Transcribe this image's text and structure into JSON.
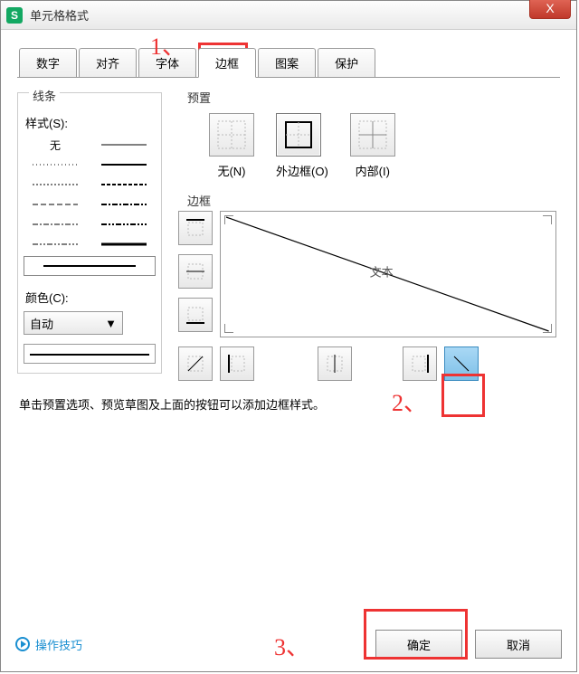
{
  "window": {
    "title": "单元格格式",
    "app_glyph": "S"
  },
  "close_btn": "X",
  "tabs": [
    "数字",
    "对齐",
    "字体",
    "边框",
    "图案",
    "保护"
  ],
  "active_tab_index": 3,
  "line_section": {
    "legend": "线条",
    "style_label": "样式(S):",
    "none_label": "无",
    "color_label": "颜色(C):",
    "color_value": "自动",
    "dropdown_glyph": "▼"
  },
  "preset_section": {
    "legend": "预置",
    "items": [
      {
        "label": "无(N)"
      },
      {
        "label": "外边框(O)"
      },
      {
        "label": "内部(I)"
      }
    ]
  },
  "border_section": {
    "legend": "边框",
    "preview_text": "文本"
  },
  "hint": "单击预置选项、预览草图及上面的按钮可以添加边框样式。",
  "footer": {
    "help": "操作技巧",
    "ok": "确定",
    "cancel": "取消"
  },
  "annotations": {
    "a1": "1、",
    "a2": "2、",
    "a3": "3、"
  }
}
